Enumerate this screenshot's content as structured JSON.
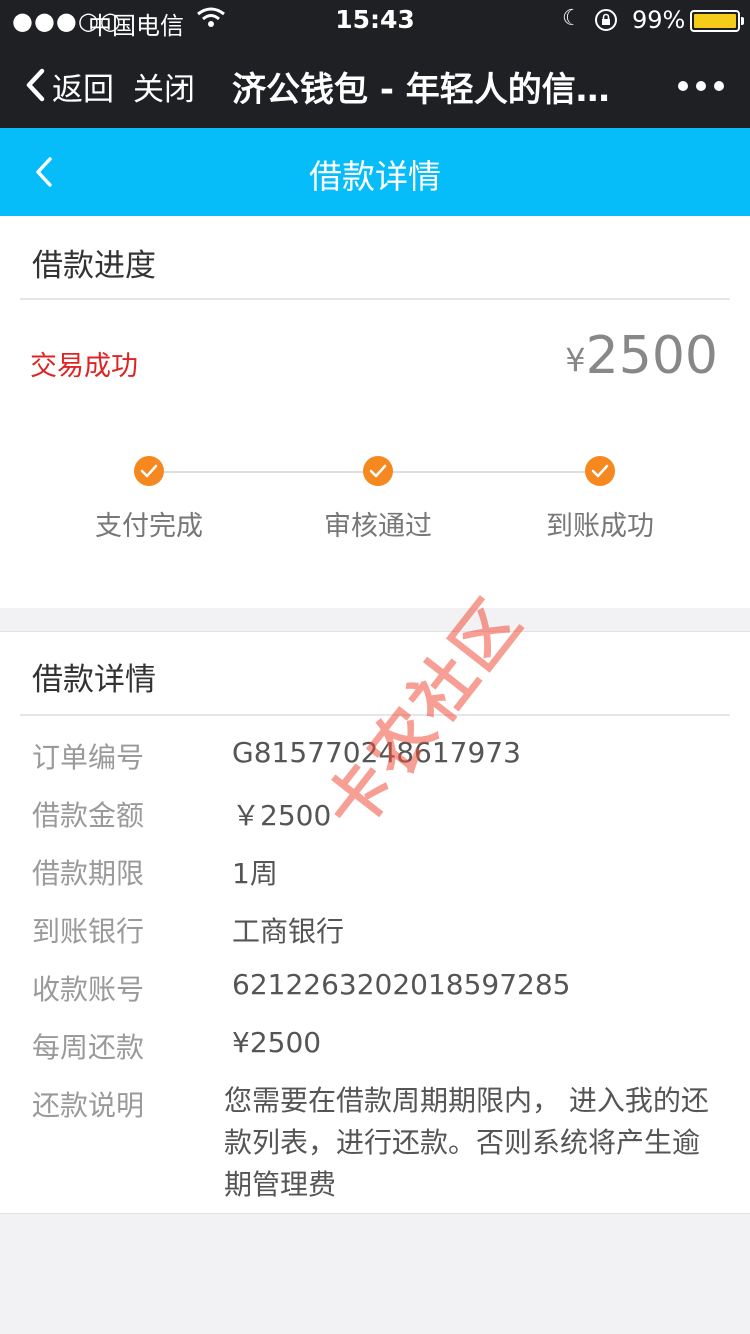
{
  "status_bar": {
    "signal": "●●●○○",
    "carrier": "中国电信",
    "time": "15:43",
    "battery": "99%",
    "battery_level": 0.99,
    "battery_color": "#f6cc1b"
  },
  "browser_nav": {
    "back_label": "返回",
    "close_label": "关闭",
    "title": "济公钱包 - 年轻人的信…"
  },
  "app_header": {
    "title": "借款详情",
    "color": "#06bdf9"
  },
  "progress": {
    "section_title": "借款进度",
    "status": "交易成功",
    "currency": "¥",
    "amount": "2500",
    "steps": [
      {
        "label": "支付完成"
      },
      {
        "label": "审核通过"
      },
      {
        "label": "到账成功"
      }
    ],
    "accent": "#f5881f",
    "status_color": "#e02424"
  },
  "details": {
    "section_title": "借款详情",
    "rows": [
      {
        "label": "订单编号",
        "value": "G815770248617973"
      },
      {
        "label": "借款金额",
        "value": "￥2500"
      },
      {
        "label": "借款期限",
        "value": "1周"
      },
      {
        "label": "到账银行",
        "value": "工商银行"
      },
      {
        "label": "收款账号",
        "value": "6212263202018597285"
      },
      {
        "label": "每周还款",
        "value": "¥2500"
      }
    ],
    "note_label": "还款说明",
    "note": "您需要在借款周期期限内， 进入我的还款列表，进行还款。否则系统将产生逾期管理费"
  },
  "watermark": "卡农社区"
}
